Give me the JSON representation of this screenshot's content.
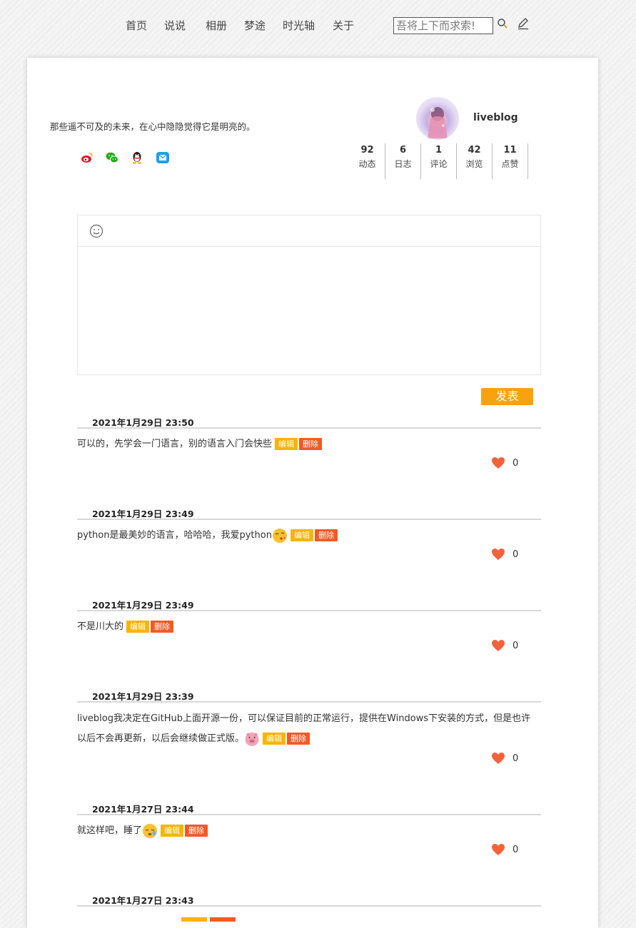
{
  "nav": {
    "items": [
      "首页",
      "说说",
      "相册",
      "梦途",
      "时光轴",
      "关于"
    ],
    "search_placeholder": "吾将上下而求索!"
  },
  "profile": {
    "motto": "那些遥不可及的未来，在心中隐隐觉得它是明亮的。",
    "username": "liveblog",
    "stats": [
      {
        "value": "92",
        "label": "动态"
      },
      {
        "value": "6",
        "label": "日志"
      },
      {
        "value": "1",
        "label": "评论"
      },
      {
        "value": "42",
        "label": "浏览"
      },
      {
        "value": "11",
        "label": "点赞"
      }
    ],
    "social": [
      "weibo-icon",
      "wechat-icon",
      "qq-icon",
      "mail-icon"
    ]
  },
  "editor": {
    "emoji_icon": "smiley-icon",
    "publish_label": "发表"
  },
  "posts": [
    {
      "date": "2021年1月29日  23:50",
      "text": "可以的，先学会一门语言，别的语言入门会快些",
      "emoji": "",
      "likes": "0"
    },
    {
      "date": "2021年1月29日  23:49",
      "text": "python是最美妙的语言，哈哈哈，我爱python",
      "emoji": "kiss-emoji",
      "likes": "0"
    },
    {
      "date": "2021年1月29日  23:49",
      "text": "不是川大的",
      "emoji": "",
      "likes": "0"
    },
    {
      "date": "2021年1月29日  23:39",
      "text": "liveblog我决定在GitHub上面开源一份，可以保证目前的正常运行，提供在Windows下安装的方式，但是也许以后不会再更新，以后会继续做正式版。",
      "emoji": "pig-emoji",
      "likes": "0"
    },
    {
      "date": "2021年1月27日  23:44",
      "text": "就这样吧，睡了",
      "emoji": "sleepy-emoji",
      "likes": "0"
    },
    {
      "date": "2021年1月27日  23:43",
      "text": "",
      "emoji": "",
      "likes": ""
    }
  ],
  "post_actions": {
    "edit": "编辑",
    "delete": "删除"
  },
  "colors": {
    "accent": "#f9a20f",
    "edit": "#f7b400",
    "delete": "#f25a24",
    "heart": "#f4623a"
  }
}
